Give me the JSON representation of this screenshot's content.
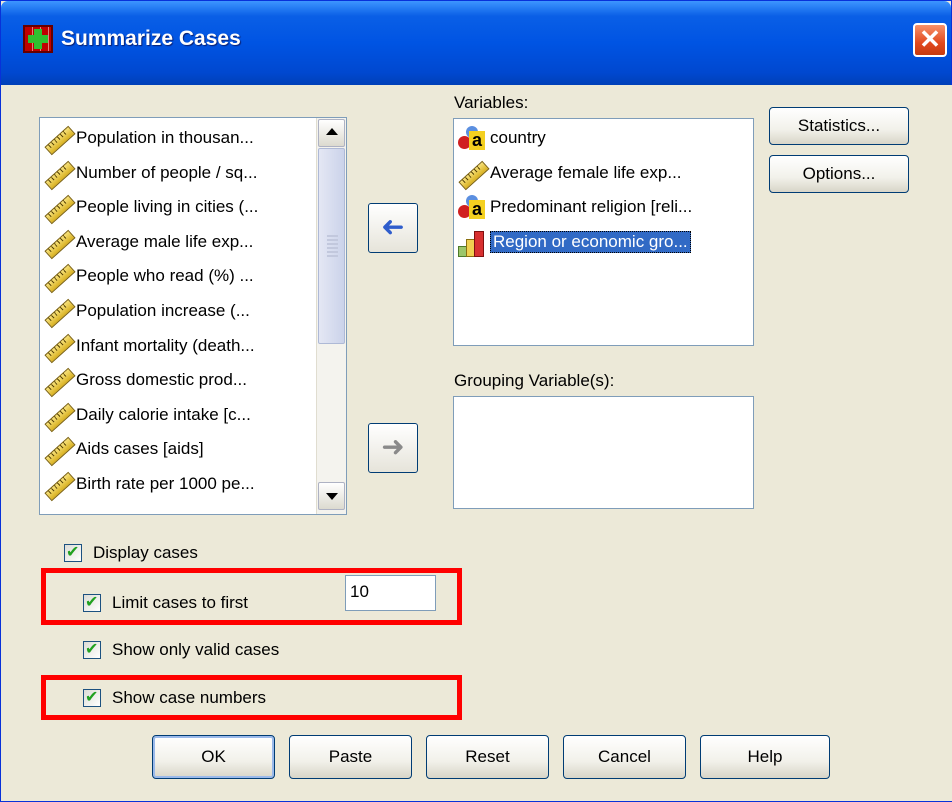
{
  "window": {
    "title": "Summarize Cases",
    "close_glyph": "✕"
  },
  "source_list": {
    "items": [
      {
        "label": "Population in thousan...",
        "icon": "scale-ruler-icon"
      },
      {
        "label": "Number of people / sq...",
        "icon": "scale-ruler-icon"
      },
      {
        "label": "People living in cities (...",
        "icon": "scale-ruler-icon"
      },
      {
        "label": "Average male life exp...",
        "icon": "scale-ruler-icon"
      },
      {
        "label": "People who read (%) ...",
        "icon": "scale-ruler-icon"
      },
      {
        "label": "Population increase (...",
        "icon": "scale-ruler-icon"
      },
      {
        "label": "Infant mortality (death...",
        "icon": "scale-ruler-icon"
      },
      {
        "label": "Gross domestic prod...",
        "icon": "scale-ruler-icon"
      },
      {
        "label": "Daily calorie intake [c...",
        "icon": "scale-ruler-icon"
      },
      {
        "label": "Aids cases [aids]",
        "icon": "scale-ruler-icon"
      },
      {
        "label": "Birth rate per 1000 pe...",
        "icon": "scale-ruler-icon"
      }
    ]
  },
  "variables": {
    "label": "Variables:",
    "items": [
      {
        "label": "country",
        "icon": "nominal-icon"
      },
      {
        "label": "Average female life exp...",
        "icon": "scale-ruler-icon"
      },
      {
        "label": "Predominant religion [reli...",
        "icon": "nominal-icon"
      },
      {
        "label": "Region or economic gro...",
        "icon": "ordinal-icon",
        "selected": true
      }
    ]
  },
  "grouping": {
    "label": "Grouping Variable(s):"
  },
  "buttons": {
    "statistics": "Statistics...",
    "options": "Options...",
    "ok": "OK",
    "paste": "Paste",
    "reset": "Reset",
    "cancel": "Cancel",
    "help": "Help"
  },
  "options": {
    "display_cases": "Display cases",
    "limit_cases": "Limit cases to first",
    "limit_value": "10",
    "valid_only": "Show only valid cases",
    "case_numbers": "Show case numbers"
  },
  "arrows": {
    "move_to_variables": "➜",
    "move_to_grouping": "➜"
  },
  "colors": {
    "title_bar": "#0054e3",
    "highlight": "#ff0000",
    "selection": "#316ac5"
  }
}
